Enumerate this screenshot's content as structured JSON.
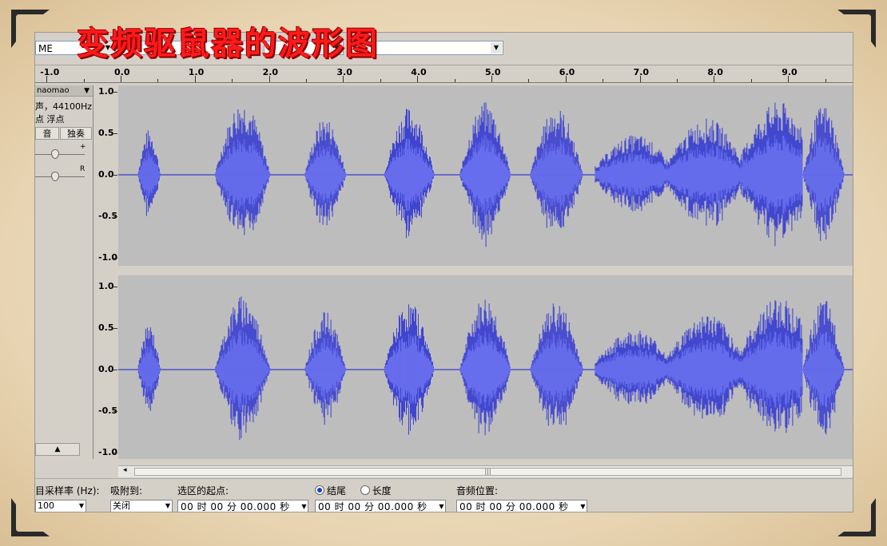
{
  "overlay_title": "变频驱鼠器的波形图",
  "toolbar": {
    "host_combo": "ME"
  },
  "ruler": {
    "labels": [
      "-1.0",
      "0.0",
      "1.0",
      "2.0",
      "3.0",
      "4.0",
      "5.0",
      "6.0",
      "7.0",
      "8.0",
      "9.0"
    ]
  },
  "track": {
    "name": "naomao",
    "info_line1": "声，44100Hz",
    "info_line2": "点 浮点",
    "mute_label": "音",
    "solo_label": "独奏"
  },
  "vscale": {
    "labels": [
      "1.0",
      "0.5",
      "0.0",
      "-0.5",
      "-1.0"
    ]
  },
  "selection_bar": {
    "rate_label": "目采样率 (Hz):",
    "rate_value": "100",
    "snap_label": "吸附到:",
    "snap_value": "关闭",
    "sel_start_label": "选区的起点:",
    "sel_start_value": "00 时 00 分 00.000 秒",
    "end_label": "结尾",
    "length_label": "长度",
    "sel_end_value": "00 时 00 分 00.000 秒",
    "pos_label": "音频位置:",
    "pos_value": "00 时 00 分 00.000 秒"
  },
  "colors": {
    "wave_fill": "#3a3fd0",
    "wave_rms": "#6a72f0",
    "wave_bg": "#bdbdbd",
    "title_red": "#ff1a1a"
  },
  "bursts": [
    {
      "start": 0.23,
      "end": 0.6,
      "amp": 0.55
    },
    {
      "start": 1.27,
      "end": 2.17,
      "amp": 0.9
    },
    {
      "start": 2.48,
      "end": 3.15,
      "amp": 0.7
    },
    {
      "start": 3.55,
      "end": 4.37,
      "amp": 0.82
    },
    {
      "start": 4.57,
      "end": 5.4,
      "amp": 0.88
    },
    {
      "start": 5.52,
      "end": 6.38,
      "amp": 0.82
    },
    {
      "start": 6.4,
      "end": 9.2,
      "amp": 0.95
    },
    {
      "start": 9.2,
      "end": 10.0,
      "amp": 0.85
    }
  ]
}
